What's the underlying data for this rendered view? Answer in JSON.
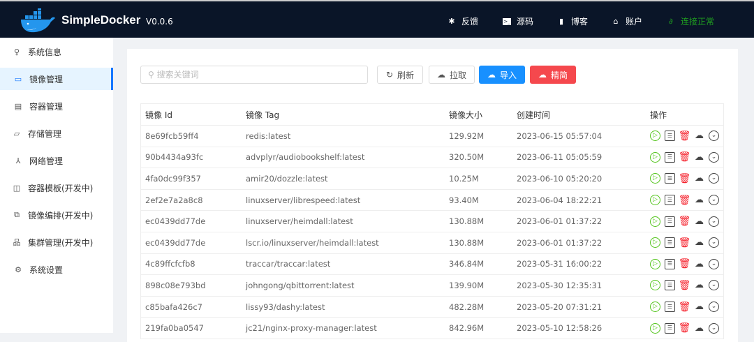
{
  "header": {
    "brand": "SimpleDocker",
    "version": "V0.0.6",
    "nav": [
      {
        "icon": "bug-icon",
        "label": "反馈"
      },
      {
        "icon": "terminal-icon",
        "label": "源码"
      },
      {
        "icon": "book-icon",
        "label": "博客"
      },
      {
        "icon": "home-icon",
        "label": "账户"
      },
      {
        "icon": "link-icon",
        "label": "连接正常"
      }
    ],
    "status_color": "#1fa01f"
  },
  "sidebar": {
    "items": [
      {
        "label": "系统信息",
        "icon": "user-icon"
      },
      {
        "label": "镜像管理",
        "icon": "laptop-icon",
        "active": true
      },
      {
        "label": "容器管理",
        "icon": "container-icon"
      },
      {
        "label": "存储管理",
        "icon": "folder-icon"
      },
      {
        "label": "网络管理",
        "icon": "network-icon"
      },
      {
        "label": "容器模板(开发中)",
        "icon": "template-icon"
      },
      {
        "label": "镜像编排(开发中)",
        "icon": "compose-icon"
      },
      {
        "label": "集群管理(开发中)",
        "icon": "cluster-icon"
      },
      {
        "label": "系统设置",
        "icon": "gear-icon"
      }
    ]
  },
  "toolbar": {
    "search_placeholder": "搜索关键词",
    "refresh": "刷新",
    "pull": "拉取",
    "import": "导入",
    "prune": "精简"
  },
  "table": {
    "headers": [
      "镜像 Id",
      "镜像 Tag",
      "镜像大小",
      "创建时间",
      "操作"
    ],
    "rows": [
      [
        "8e69fcb59ff4",
        "redis:latest",
        "129.92M",
        "2023-06-15 05:57:04"
      ],
      [
        "90b4434a93fc",
        "advplyr/audiobookshelf:latest",
        "320.50M",
        "2023-06-11 05:05:59"
      ],
      [
        "4fa0dc99f357",
        "amir20/dozzle:latest",
        "10.25M",
        "2023-06-10 05:20:20"
      ],
      [
        "2ef2e7a2a8c8",
        "linuxserver/librespeed:latest",
        "93.40M",
        "2023-06-04 18:22:21"
      ],
      [
        "ec0439dd77de",
        "linuxserver/heimdall:latest",
        "130.88M",
        "2023-06-01 01:37:22"
      ],
      [
        "ec0439dd77de",
        "lscr.io/linuxserver/heimdall:latest",
        "130.88M",
        "2023-06-01 01:37:22"
      ],
      [
        "4c89ffcfcfb8",
        "traccar/traccar:latest",
        "346.84M",
        "2023-05-31 16:00:22"
      ],
      [
        "898c08e793bd",
        "johngong/qbittorrent:latest",
        "139.90M",
        "2023-05-30 12:35:31"
      ],
      [
        "c85bafa426c7",
        "lissy93/dashy:latest",
        "482.28M",
        "2023-05-20 07:31:21"
      ],
      [
        "219fa0ba0547",
        "jc21/nginx-proxy-manager:latest",
        "842.96M",
        "2023-05-10 12:58:26"
      ]
    ]
  }
}
